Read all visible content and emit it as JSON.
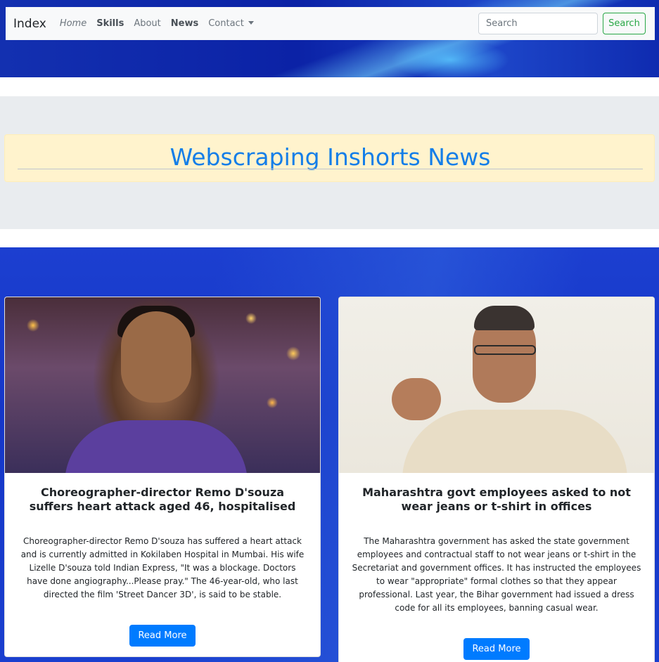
{
  "navbar": {
    "brand": "Index",
    "links": [
      "Home",
      "Skills",
      "About",
      "News",
      "Contact"
    ],
    "search_placeholder": "Search",
    "search_button": "Search"
  },
  "jumbotron": {
    "title": "Webscraping Inshorts News"
  },
  "colors": {
    "title_blue": "#147ee8",
    "search_green": "#28a745",
    "button_blue": "#007bff",
    "banner_blue": "#1536c8"
  },
  "news": [
    {
      "headline": "Choreographer-director Remo D'souza suffers heart attack aged 46, hospitalised",
      "body": "Choreographer-director Remo D'souza has suffered a heart attack and is currently admitted in Kokilaben Hospital in Mumbai. His wife Lizelle D'souza told Indian Express, \"It was a blockage. Doctors have done angiography...Please pray.\" The 46-year-old, who last directed the film 'Street Dancer 3D', is said to be stable.",
      "button": "Read More"
    },
    {
      "headline": "Maharashtra govt employees asked to not wear jeans or t-shirt in offices",
      "body": "The Maharashtra government has asked the state government employees and contractual staff to not wear jeans or t-shirt in the Secretariat and government offices. It has instructed the employees to wear \"appropriate\" formal clothes so that they appear professional. Last year, the Bihar government had issued a dress code for all its employees, banning casual wear.",
      "button": "Read More"
    }
  ]
}
